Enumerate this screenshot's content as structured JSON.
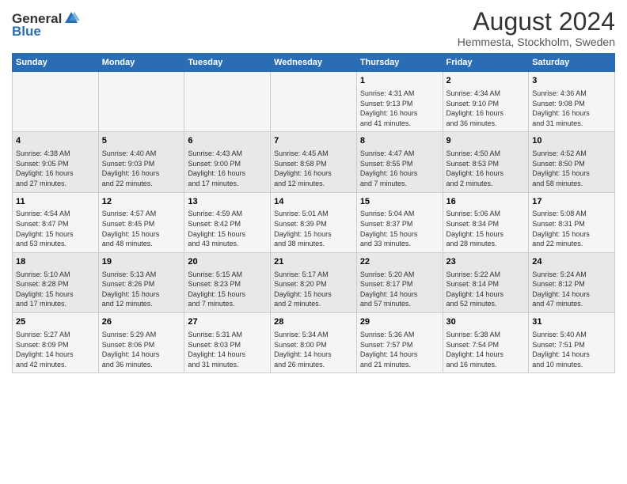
{
  "logo": {
    "general": "General",
    "blue": "Blue"
  },
  "title": "August 2024",
  "subtitle": "Hemmesta, Stockholm, Sweden",
  "weekdays": [
    "Sunday",
    "Monday",
    "Tuesday",
    "Wednesday",
    "Thursday",
    "Friday",
    "Saturday"
  ],
  "weeks": [
    [
      {
        "day": "",
        "info": ""
      },
      {
        "day": "",
        "info": ""
      },
      {
        "day": "",
        "info": ""
      },
      {
        "day": "",
        "info": ""
      },
      {
        "day": "1",
        "info": "Sunrise: 4:31 AM\nSunset: 9:13 PM\nDaylight: 16 hours\nand 41 minutes."
      },
      {
        "day": "2",
        "info": "Sunrise: 4:34 AM\nSunset: 9:10 PM\nDaylight: 16 hours\nand 36 minutes."
      },
      {
        "day": "3",
        "info": "Sunrise: 4:36 AM\nSunset: 9:08 PM\nDaylight: 16 hours\nand 31 minutes."
      }
    ],
    [
      {
        "day": "4",
        "info": "Sunrise: 4:38 AM\nSunset: 9:05 PM\nDaylight: 16 hours\nand 27 minutes."
      },
      {
        "day": "5",
        "info": "Sunrise: 4:40 AM\nSunset: 9:03 PM\nDaylight: 16 hours\nand 22 minutes."
      },
      {
        "day": "6",
        "info": "Sunrise: 4:43 AM\nSunset: 9:00 PM\nDaylight: 16 hours\nand 17 minutes."
      },
      {
        "day": "7",
        "info": "Sunrise: 4:45 AM\nSunset: 8:58 PM\nDaylight: 16 hours\nand 12 minutes."
      },
      {
        "day": "8",
        "info": "Sunrise: 4:47 AM\nSunset: 8:55 PM\nDaylight: 16 hours\nand 7 minutes."
      },
      {
        "day": "9",
        "info": "Sunrise: 4:50 AM\nSunset: 8:53 PM\nDaylight: 16 hours\nand 2 minutes."
      },
      {
        "day": "10",
        "info": "Sunrise: 4:52 AM\nSunset: 8:50 PM\nDaylight: 15 hours\nand 58 minutes."
      }
    ],
    [
      {
        "day": "11",
        "info": "Sunrise: 4:54 AM\nSunset: 8:47 PM\nDaylight: 15 hours\nand 53 minutes."
      },
      {
        "day": "12",
        "info": "Sunrise: 4:57 AM\nSunset: 8:45 PM\nDaylight: 15 hours\nand 48 minutes."
      },
      {
        "day": "13",
        "info": "Sunrise: 4:59 AM\nSunset: 8:42 PM\nDaylight: 15 hours\nand 43 minutes."
      },
      {
        "day": "14",
        "info": "Sunrise: 5:01 AM\nSunset: 8:39 PM\nDaylight: 15 hours\nand 38 minutes."
      },
      {
        "day": "15",
        "info": "Sunrise: 5:04 AM\nSunset: 8:37 PM\nDaylight: 15 hours\nand 33 minutes."
      },
      {
        "day": "16",
        "info": "Sunrise: 5:06 AM\nSunset: 8:34 PM\nDaylight: 15 hours\nand 28 minutes."
      },
      {
        "day": "17",
        "info": "Sunrise: 5:08 AM\nSunset: 8:31 PM\nDaylight: 15 hours\nand 22 minutes."
      }
    ],
    [
      {
        "day": "18",
        "info": "Sunrise: 5:10 AM\nSunset: 8:28 PM\nDaylight: 15 hours\nand 17 minutes."
      },
      {
        "day": "19",
        "info": "Sunrise: 5:13 AM\nSunset: 8:26 PM\nDaylight: 15 hours\nand 12 minutes."
      },
      {
        "day": "20",
        "info": "Sunrise: 5:15 AM\nSunset: 8:23 PM\nDaylight: 15 hours\nand 7 minutes."
      },
      {
        "day": "21",
        "info": "Sunrise: 5:17 AM\nSunset: 8:20 PM\nDaylight: 15 hours\nand 2 minutes."
      },
      {
        "day": "22",
        "info": "Sunrise: 5:20 AM\nSunset: 8:17 PM\nDaylight: 14 hours\nand 57 minutes."
      },
      {
        "day": "23",
        "info": "Sunrise: 5:22 AM\nSunset: 8:14 PM\nDaylight: 14 hours\nand 52 minutes."
      },
      {
        "day": "24",
        "info": "Sunrise: 5:24 AM\nSunset: 8:12 PM\nDaylight: 14 hours\nand 47 minutes."
      }
    ],
    [
      {
        "day": "25",
        "info": "Sunrise: 5:27 AM\nSunset: 8:09 PM\nDaylight: 14 hours\nand 42 minutes."
      },
      {
        "day": "26",
        "info": "Sunrise: 5:29 AM\nSunset: 8:06 PM\nDaylight: 14 hours\nand 36 minutes."
      },
      {
        "day": "27",
        "info": "Sunrise: 5:31 AM\nSunset: 8:03 PM\nDaylight: 14 hours\nand 31 minutes."
      },
      {
        "day": "28",
        "info": "Sunrise: 5:34 AM\nSunset: 8:00 PM\nDaylight: 14 hours\nand 26 minutes."
      },
      {
        "day": "29",
        "info": "Sunrise: 5:36 AM\nSunset: 7:57 PM\nDaylight: 14 hours\nand 21 minutes."
      },
      {
        "day": "30",
        "info": "Sunrise: 5:38 AM\nSunset: 7:54 PM\nDaylight: 14 hours\nand 16 minutes."
      },
      {
        "day": "31",
        "info": "Sunrise: 5:40 AM\nSunset: 7:51 PM\nDaylight: 14 hours\nand 10 minutes."
      }
    ]
  ]
}
